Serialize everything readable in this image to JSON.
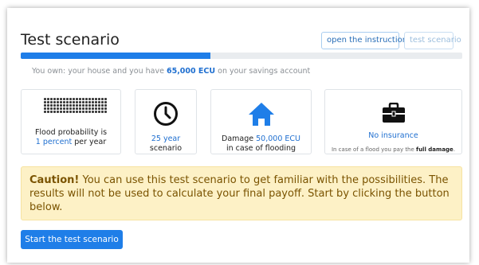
{
  "header": {
    "title": "Test scenario",
    "instructions_button": "open the instructions",
    "test_button": "test scenario"
  },
  "progress": {
    "fraction": 0.43
  },
  "ownership": {
    "prefix": "You own: your house and you have ",
    "amount": "65,000 ECU",
    "suffix": " on your savings account"
  },
  "cards": {
    "flood": {
      "icon": "dot-grid-icon",
      "line1": "Flood probability is",
      "value": "1 percent",
      "line2": " per year"
    },
    "duration": {
      "icon": "clock-icon",
      "value": "25 year",
      "line2": "scenario"
    },
    "damage": {
      "icon": "house-icon",
      "prefix": "Damage ",
      "value": "50,000 ECU",
      "line2": "in case of flooding"
    },
    "insurance": {
      "icon": "briefcase-icon",
      "title": "No insurance",
      "note_prefix": "In case of a flood you pay the ",
      "note_bold": "full damage",
      "note_suffix": "."
    }
  },
  "caution": {
    "label": "Caution!",
    "text": " You can use this test scenario to get familiar with the possibilities. The results will not be used to calculate your final payoff. Start by clicking the button below."
  },
  "start_button": "Start the test scenario",
  "colors": {
    "primary": "#1f7ee8",
    "caution_bg": "#fdf1c6",
    "caution_text": "#7a5300"
  }
}
